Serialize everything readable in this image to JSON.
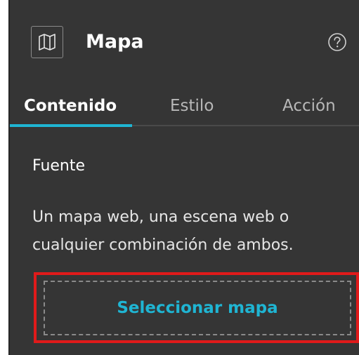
{
  "header": {
    "icon": "map-icon",
    "title": "Mapa",
    "help_icon": "question-circle-icon"
  },
  "tabs": [
    {
      "label": "Contenido",
      "active": true
    },
    {
      "label": "Estilo",
      "active": false
    },
    {
      "label": "Acción",
      "active": false
    }
  ],
  "content": {
    "section_label": "Fuente",
    "description": "Un mapa web, una escena web o cualquier combinación de ambos.",
    "select_button_label": "Seleccionar mapa"
  },
  "colors": {
    "panel_background": "#353535",
    "accent": "#1fb5d3",
    "highlight": "#e01a1a"
  }
}
